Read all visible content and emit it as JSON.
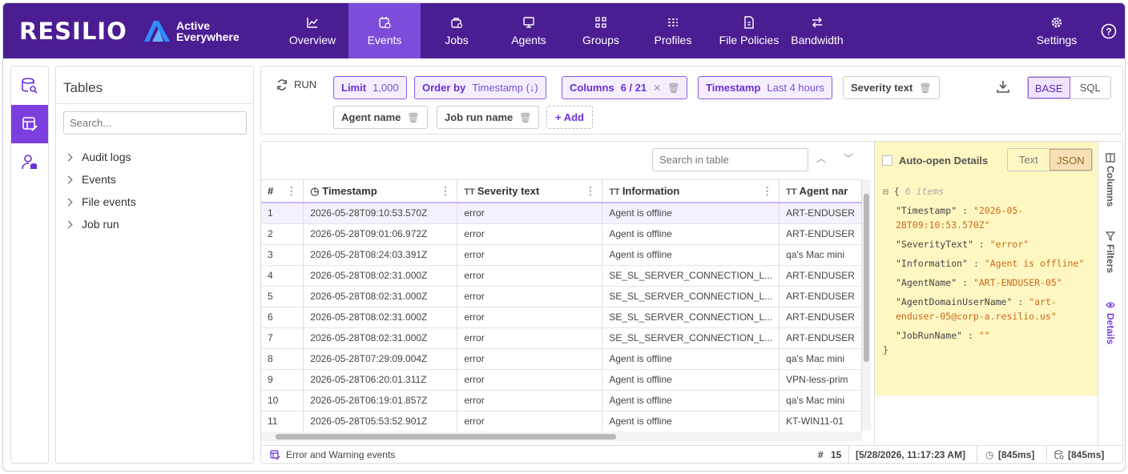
{
  "brand": {
    "name": "RESILIO",
    "product_line1": "Active",
    "product_line2": "Everywhere"
  },
  "nav": {
    "items": [
      {
        "label": "Overview"
      },
      {
        "label": "Events"
      },
      {
        "label": "Jobs"
      },
      {
        "label": "Agents"
      },
      {
        "label": "Groups"
      },
      {
        "label": "Profiles"
      },
      {
        "label": "File Policies"
      },
      {
        "label": "Bandwidth"
      }
    ],
    "settings": "Settings",
    "active": "Events"
  },
  "tables": {
    "title": "Tables",
    "search_placeholder": "Search...",
    "items": [
      "Audit logs",
      "Events",
      "File events",
      "Job run"
    ]
  },
  "toolbar": {
    "run": "RUN",
    "limit_label": "Limit",
    "limit_value": "1,000",
    "order_label": "Order by",
    "order_value": "Timestamp (↓)",
    "columns_label": "Columns",
    "columns_value": "6 / 21",
    "timestamp_label": "Timestamp",
    "timestamp_value": "Last 4 hours",
    "severity_label": "Severity text",
    "agent_label": "Agent name",
    "jobrun_label": "Job run name",
    "add": "+ Add",
    "base": "BASE",
    "sql": "SQL"
  },
  "table": {
    "search_placeholder": "Search in table",
    "columns": [
      "#",
      "Timestamp",
      "Severity text",
      "Information",
      "Agent nar"
    ],
    "rows": [
      [
        "1",
        "2026-05-28T09:10:53.570Z",
        "error",
        "Agent is offline",
        "ART-ENDUSER"
      ],
      [
        "2",
        "2026-05-28T09:01:06.972Z",
        "error",
        "Agent is offline",
        "ART-ENDUSER"
      ],
      [
        "3",
        "2026-05-28T08:24:03.391Z",
        "error",
        "Agent is offline",
        "qa's Mac mini"
      ],
      [
        "4",
        "2026-05-28T08:02:31.000Z",
        "error",
        "SE_SL_SERVER_CONNECTION_L...",
        "ART-ENDUSER"
      ],
      [
        "5",
        "2026-05-28T08:02:31.000Z",
        "error",
        "SE_SL_SERVER_CONNECTION_L...",
        "ART-ENDUSER"
      ],
      [
        "6",
        "2026-05-28T08:02:31.000Z",
        "error",
        "SE_SL_SERVER_CONNECTION_L...",
        "ART-ENDUSER"
      ],
      [
        "7",
        "2026-05-28T08:02:31.000Z",
        "error",
        "SE_SL_SERVER_CONNECTION_L...",
        "ART-ENDUSER"
      ],
      [
        "8",
        "2026-05-28T07:29:09.004Z",
        "error",
        "Agent is offline",
        "qa's Mac mini"
      ],
      [
        "9",
        "2026-05-28T06:20:01.311Z",
        "error",
        "Agent is offline",
        "VPN-less-prim"
      ],
      [
        "10",
        "2026-05-28T06:19:01.857Z",
        "error",
        "Agent is offline",
        "qa's Mac mini"
      ],
      [
        "11",
        "2026-05-28T05:53:52.901Z",
        "error",
        "Agent is offline",
        "KT-WIN11-01"
      ]
    ]
  },
  "details": {
    "auto_open": "Auto-open Details",
    "text": "Text",
    "json": "JSON",
    "items_count": "6 items",
    "pairs": [
      {
        "key": "\"Timestamp\"",
        "value": "\"2026-05-28T09:10:53.570Z\""
      },
      {
        "key": "\"SeverityText\"",
        "value": "\"error\""
      },
      {
        "key": "\"Information\"",
        "value": "\"Agent is offline\""
      },
      {
        "key": "\"AgentName\"",
        "value": "\"ART-ENDUSER-05\""
      },
      {
        "key": "\"AgentDomainUserName\"",
        "value": "\"art-enduser-05@corp-a.resilio.us\""
      },
      {
        "key": "\"JobRunName\"",
        "value": "\"\""
      }
    ]
  },
  "vtabs": [
    "Columns",
    "Filters",
    "Details"
  ],
  "status": {
    "title": "Error and Warning events",
    "count_label": "#",
    "count": "15",
    "datetime": "[5/28/2026, 11:17:23 AM]",
    "time1": "[845ms]",
    "time2": "[845ms]"
  },
  "colors": {
    "nav_bg": "#4b1d92",
    "nav_active": "#7d4cdb",
    "accent": "#7d3ee0",
    "details_bg": "#fff7c2"
  }
}
